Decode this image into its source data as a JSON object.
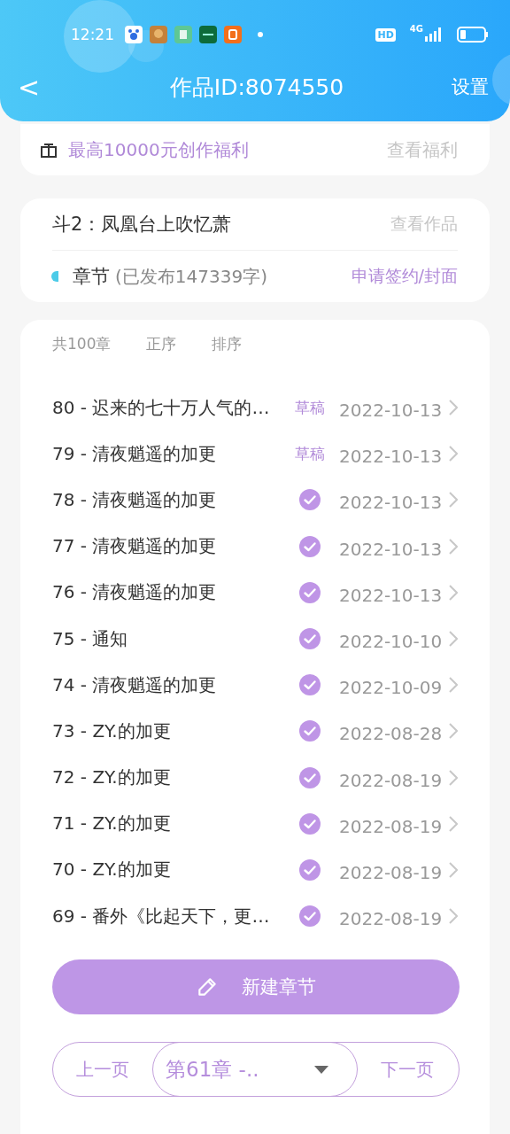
{
  "status_bar": {
    "time": "12:21",
    "hd": "HD",
    "network": "4G"
  },
  "header": {
    "back": "<",
    "title": "作品ID:8074550",
    "settings": "设置"
  },
  "welfare": {
    "text": "最高10000元创作福利",
    "link": "查看福利"
  },
  "work": {
    "title": "斗2：凤凰台上吹忆萧",
    "link": "查看作品",
    "section": "章节",
    "published": "(已发布147339字)",
    "apply": "申请签约/封面"
  },
  "list_header": {
    "count": "共100章",
    "order": "正序",
    "sort": "排序"
  },
  "chapters": [
    {
      "title": "80 - 迟来的七十万人气的…",
      "kind": "draft",
      "status": "草稿",
      "date": "2022-10-13"
    },
    {
      "title": "79 - 清夜魈遥的加更",
      "kind": "draft",
      "status": "草稿",
      "date": "2022-10-13"
    },
    {
      "title": "78 - 清夜魈遥的加更",
      "kind": "published",
      "date": "2022-10-13"
    },
    {
      "title": "77 - 清夜魈遥的加更",
      "kind": "published",
      "date": "2022-10-13"
    },
    {
      "title": "76 - 清夜魈遥的加更",
      "kind": "published",
      "date": "2022-10-13"
    },
    {
      "title": "75 - 通知",
      "kind": "published",
      "date": "2022-10-10"
    },
    {
      "title": "74 - 清夜魈遥的加更",
      "kind": "published",
      "date": "2022-10-09"
    },
    {
      "title": "73 - ZY.的加更",
      "kind": "published",
      "date": "2022-08-28"
    },
    {
      "title": "72 - ZY.的加更",
      "kind": "published",
      "date": "2022-08-19"
    },
    {
      "title": "71 - ZY.的加更",
      "kind": "published",
      "date": "2022-08-19"
    },
    {
      "title": "70 - ZY.的加更",
      "kind": "published",
      "date": "2022-08-19"
    },
    {
      "title": "69 - 番外《比起天下，更…",
      "kind": "published",
      "date": "2022-08-19"
    }
  ],
  "new_chapter": "新建章节",
  "pager": {
    "prev": "上一页",
    "current": "第61章 -..",
    "next": "下一页"
  }
}
